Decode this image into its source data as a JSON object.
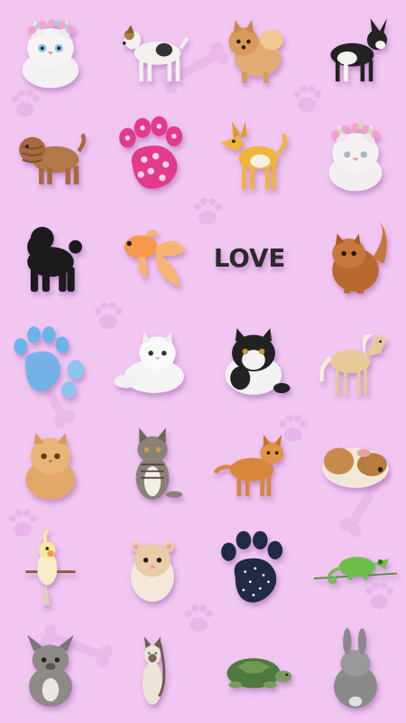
{
  "screen": {
    "background_color": "#f1c6f1",
    "pattern_color": "#e2a8e4"
  },
  "stickers": [
    {
      "icon": "cat-flower-crown-icon",
      "label": ""
    },
    {
      "icon": "terrier-dog-icon",
      "label": ""
    },
    {
      "icon": "pomeranian-dog-icon",
      "label": ""
    },
    {
      "icon": "french-bulldog-icon",
      "label": ""
    },
    {
      "icon": "sharpei-dog-icon",
      "label": ""
    },
    {
      "icon": "polka-dot-paw-icon",
      "label": ""
    },
    {
      "icon": "cartoon-dog-icon",
      "label": ""
    },
    {
      "icon": "cat-flower-crown-icon",
      "label": ""
    },
    {
      "icon": "poodle-dog-icon",
      "label": ""
    },
    {
      "icon": "goldfish-icon",
      "label": ""
    },
    {
      "icon": "love-text-icon",
      "label": "LOVE"
    },
    {
      "icon": "persian-cat-icon",
      "label": ""
    },
    {
      "icon": "blue-paw-icon",
      "label": ""
    },
    {
      "icon": "white-persian-cat-icon",
      "label": ""
    },
    {
      "icon": "black-white-cat-icon",
      "label": ""
    },
    {
      "icon": "pony-icon",
      "label": ""
    },
    {
      "icon": "ginger-persian-cat-icon",
      "label": ""
    },
    {
      "icon": "tabby-kitten-icon",
      "label": ""
    },
    {
      "icon": "orange-tabby-cat-icon",
      "label": ""
    },
    {
      "icon": "guinea-pig-icon",
      "label": ""
    },
    {
      "icon": "cockatiel-icon",
      "label": ""
    },
    {
      "icon": "hamster-icon",
      "label": ""
    },
    {
      "icon": "dotted-paw-icon",
      "label": ""
    },
    {
      "icon": "chameleon-icon",
      "label": ""
    },
    {
      "icon": "french-bulldog-sitting-icon",
      "label": ""
    },
    {
      "icon": "siamese-cat-icon",
      "label": ""
    },
    {
      "icon": "turtle-icon",
      "label": ""
    },
    {
      "icon": "rabbit-icon",
      "label": ""
    }
  ]
}
